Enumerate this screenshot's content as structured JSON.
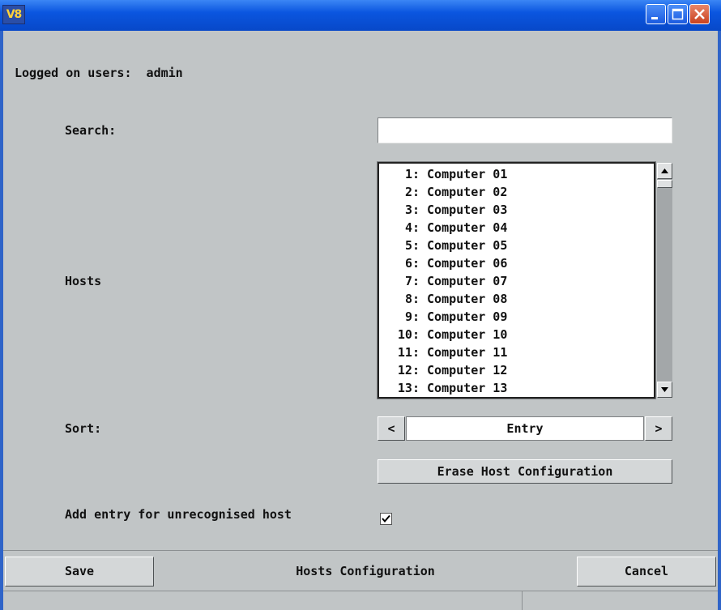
{
  "window": {
    "app_logo_text": "V8",
    "logo_color": "#ffd23a",
    "titlebar_color": "#0b56e0"
  },
  "header": {
    "logged_on_text": "Logged on users:  admin"
  },
  "form": {
    "search_label": "Search:",
    "search_value": "",
    "hosts_label": "Hosts",
    "hosts": [
      {
        "num": "1:",
        "name": "Computer 01"
      },
      {
        "num": "2:",
        "name": "Computer 02"
      },
      {
        "num": "3:",
        "name": "Computer 03"
      },
      {
        "num": "4:",
        "name": "Computer 04"
      },
      {
        "num": "5:",
        "name": "Computer 05"
      },
      {
        "num": "6:",
        "name": "Computer 06"
      },
      {
        "num": "7:",
        "name": "Computer 07"
      },
      {
        "num": "8:",
        "name": "Computer 08"
      },
      {
        "num": "9:",
        "name": "Computer 09"
      },
      {
        "num": "10:",
        "name": "Computer 10"
      },
      {
        "num": "11:",
        "name": "Computer 11"
      },
      {
        "num": "12:",
        "name": "Computer 12"
      },
      {
        "num": "13:",
        "name": "Computer 13"
      }
    ],
    "sort_label": "Sort:",
    "sort_prev": "<",
    "sort_value": "Entry",
    "sort_next": ">",
    "erase_label": "Erase Host Configuration",
    "add_entry_label": "Add entry for unrecognised host",
    "add_entry_checked": true
  },
  "footer": {
    "save_label": "Save",
    "title": "Hosts Configuration",
    "cancel_label": "Cancel"
  }
}
